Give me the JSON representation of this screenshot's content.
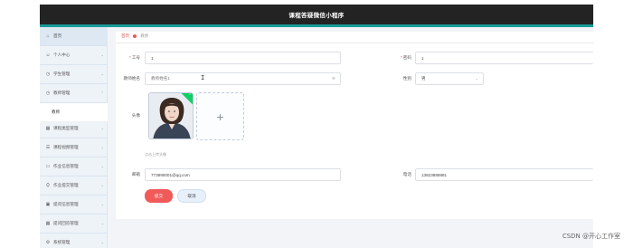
{
  "header": {
    "title": "课程答疑微信小程序"
  },
  "sidebar": {
    "items": [
      {
        "label": "首页",
        "icon": "home-icon",
        "glyph": "⌂"
      },
      {
        "label": "个人中心",
        "icon": "user-icon",
        "glyph": "👤"
      },
      {
        "label": "学生管理",
        "icon": "clock-icon",
        "glyph": "◷"
      },
      {
        "label": "教师管理",
        "icon": "clock-icon",
        "glyph": "◷"
      },
      {
        "label": "教师",
        "icon": "",
        "glyph": ""
      },
      {
        "label": "课程类型管理",
        "icon": "grid-icon",
        "glyph": "▦"
      },
      {
        "label": "课程视频管理",
        "icon": "list-icon",
        "glyph": "☰"
      },
      {
        "label": "作业信息管理",
        "icon": "document-icon",
        "glyph": "▭"
      },
      {
        "label": "作业提交管理",
        "icon": "upload-icon",
        "glyph": "⛭"
      },
      {
        "label": "提问信息管理",
        "icon": "chat-icon",
        "glyph": "▣"
      },
      {
        "label": "提问回答管理",
        "icon": "grid-icon",
        "glyph": "▦"
      },
      {
        "label": "系统管理",
        "icon": "settings-icon",
        "glyph": "⚙"
      }
    ]
  },
  "breadcrumb": {
    "home": "首页",
    "current": "教师"
  },
  "form": {
    "job_no": {
      "label": "工号",
      "value": "1"
    },
    "password": {
      "label": "密码",
      "value": "1"
    },
    "name": {
      "label": "教师姓名",
      "value": "教师姓名1"
    },
    "gender": {
      "label": "性别",
      "value": "男"
    },
    "avatar": {
      "label": "头像",
      "hint": "点击上传头像",
      "upload_glyph": "+",
      "success_glyph": "✓"
    },
    "email": {
      "label": "邮箱",
      "value": "773890001@qq.com"
    },
    "phone": {
      "label": "电话",
      "value": "13823888881"
    }
  },
  "buttons": {
    "submit": "提交",
    "cancel": "取消"
  },
  "watermark": "CSDN @开心工作室",
  "colors": {
    "header": "#232323",
    "accent": "#1a9a9a",
    "primary": "#f25a5a",
    "success": "#13ce66"
  }
}
